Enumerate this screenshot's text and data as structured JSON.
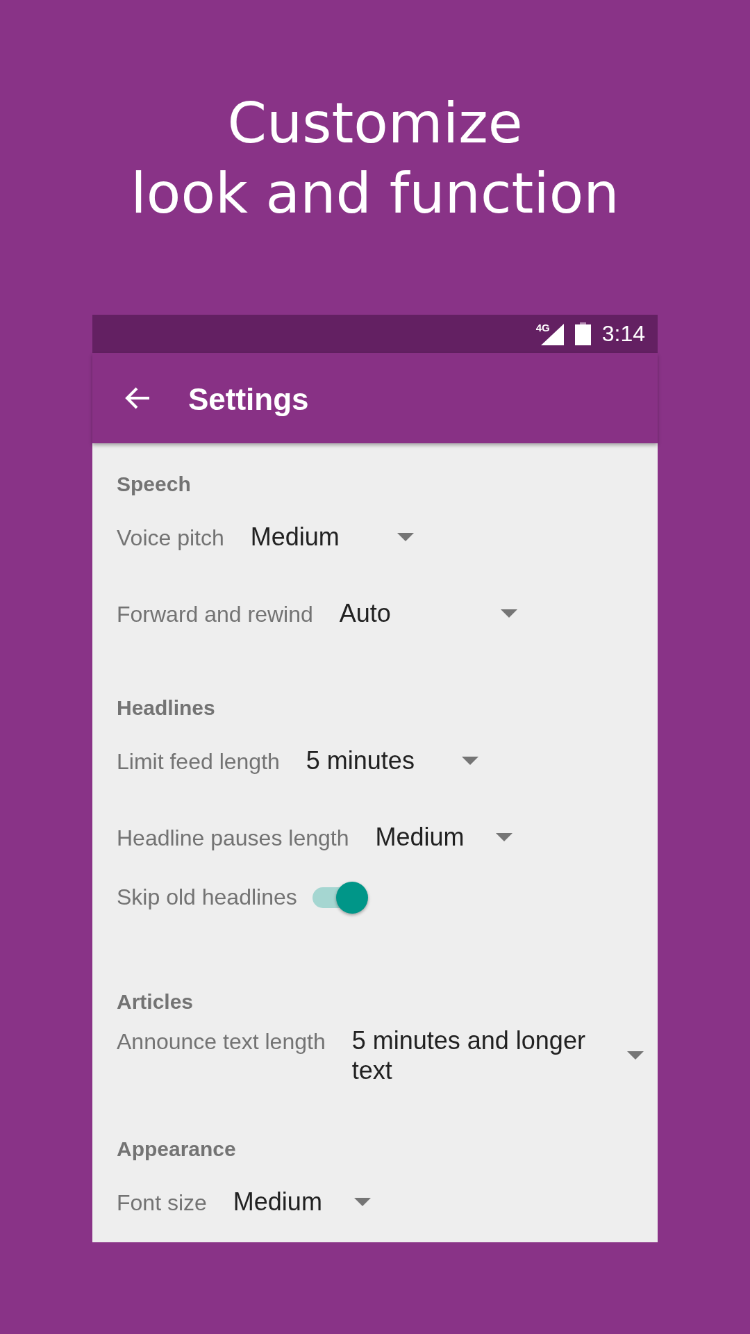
{
  "headline": {
    "lines": [
      "Customize",
      "look and function"
    ]
  },
  "status_bar": {
    "network_type": "4G",
    "time": "3:14"
  },
  "app_bar": {
    "title": "Settings"
  },
  "sections": [
    {
      "title": "Speech",
      "items": [
        {
          "kind": "dropdown",
          "label": "Voice pitch",
          "value": "Medium"
        },
        {
          "kind": "dropdown",
          "label": "Forward and rewind",
          "value": "Auto"
        }
      ]
    },
    {
      "title": "Headlines",
      "items": [
        {
          "kind": "dropdown",
          "label": "Limit feed length",
          "value": "5 minutes"
        },
        {
          "kind": "dropdown",
          "label": "Headline pauses length",
          "value": "Medium"
        },
        {
          "kind": "toggle",
          "label": "Skip old headlines",
          "on": true
        }
      ]
    },
    {
      "title": "Articles",
      "items": [
        {
          "kind": "dropdown",
          "label": "Announce text length",
          "value": "5 minutes and longer text"
        }
      ]
    },
    {
      "title": "Appearance",
      "items": [
        {
          "kind": "dropdown",
          "label": "Font size",
          "value": "Medium"
        }
      ]
    }
  ]
}
